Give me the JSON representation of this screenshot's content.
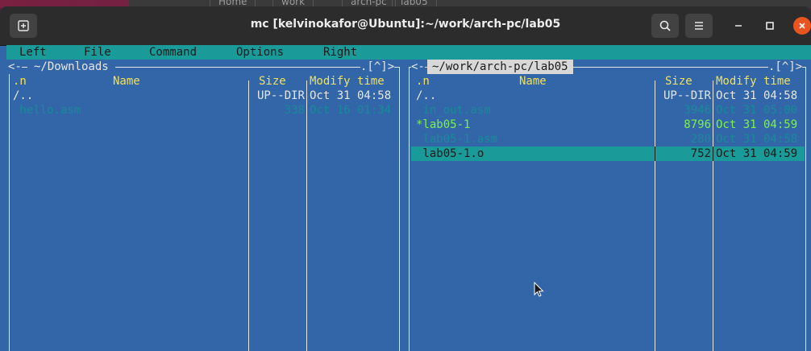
{
  "window": {
    "title": "mc [kelvinokafor@Ubuntu]:~/work/arch-pc/lab05"
  },
  "behind": {
    "crumbs": [
      "Home",
      "work",
      "arch-pc",
      "lab05"
    ]
  },
  "menu": [
    "Left",
    "File",
    "Command",
    "Options",
    "Right"
  ],
  "left_panel": {
    "path": "~/Downloads",
    "corner": ".[^]>",
    "headers": {
      "sort": ".n",
      "name": "Name",
      "size": "Size",
      "modify": "Modify time"
    },
    "rows": [
      {
        "name": "/..",
        "size": "UP--DIR",
        "time": "Oct 31 04:58",
        "style": "white"
      },
      {
        "name": " hello.asm",
        "size": "338",
        "time": "Oct 16 01:34",
        "style": "gray"
      }
    ]
  },
  "right_panel": {
    "path": "~/work/arch-pc/lab05",
    "corner": ".[^]>",
    "headers": {
      "sort": ".n",
      "name": "Name",
      "size": "Size",
      "modify": "Modify time"
    },
    "rows": [
      {
        "name": "/..",
        "size": "UP--DIR",
        "time": "Oct 31 04:58",
        "style": "white"
      },
      {
        "name": " in_out.asm",
        "size": "3946",
        "time": "Oct 31 05:00",
        "style": "gray"
      },
      {
        "name": "*lab05-1",
        "size": "8796",
        "time": "Oct 31 04:59",
        "style": "green"
      },
      {
        "name": " lab05-1.asm",
        "size": "280",
        "time": "Oct 31 04:58",
        "style": "gray"
      },
      {
        "name": " lab05-1.o",
        "size": "752",
        "time": "Oct 31 04:59",
        "style": "selected"
      }
    ]
  },
  "colors": {
    "panel_bg": "#3366a8",
    "menubar": "#1a9a98",
    "header": "#f0e060",
    "executable": "#7cf050"
  },
  "icons": [
    "new-tab-icon",
    "search-icon",
    "hamburger-menu-icon",
    "minimize-icon",
    "maximize-icon",
    "close-icon",
    "mouse-pointer-icon"
  ]
}
